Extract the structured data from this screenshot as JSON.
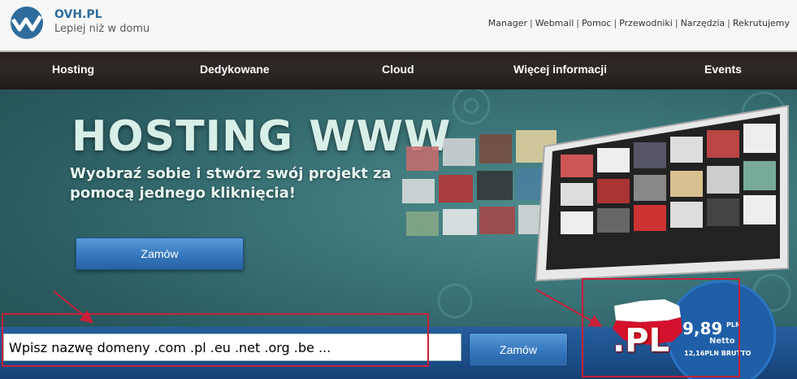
{
  "header": {
    "brand": "OVH.PL",
    "tagline": "Lepiej niż w domu",
    "links": [
      "Manager",
      "Webmail",
      "Pomoc",
      "Przewodniki",
      "Narzędzia",
      "Rekrutujemy"
    ],
    "separator": "|"
  },
  "nav": {
    "items": [
      "Hosting",
      "Dedykowane",
      "Cloud",
      "Więcej informacji",
      "Events"
    ]
  },
  "banner": {
    "title": "HOSTING WWW",
    "subtitle": "Wyobraź sobie i stwórz swój projekt za pomocą jednego kliknięcia!",
    "order_label": "Zamów"
  },
  "domain": {
    "input_value": "Wpisz nazwę domeny .com .pl .eu .net .org .be ...",
    "order_label": "Zamów"
  },
  "promo": {
    "tld": ".PL",
    "price": "9,89",
    "currency": "PLN",
    "netto": "Netto",
    "brutto": "12,16PLN BRUTTO"
  },
  "colors": {
    "accent_blue": "#3577be",
    "annotation_red": "#c8203a",
    "nav_bg": "#2b2322"
  }
}
